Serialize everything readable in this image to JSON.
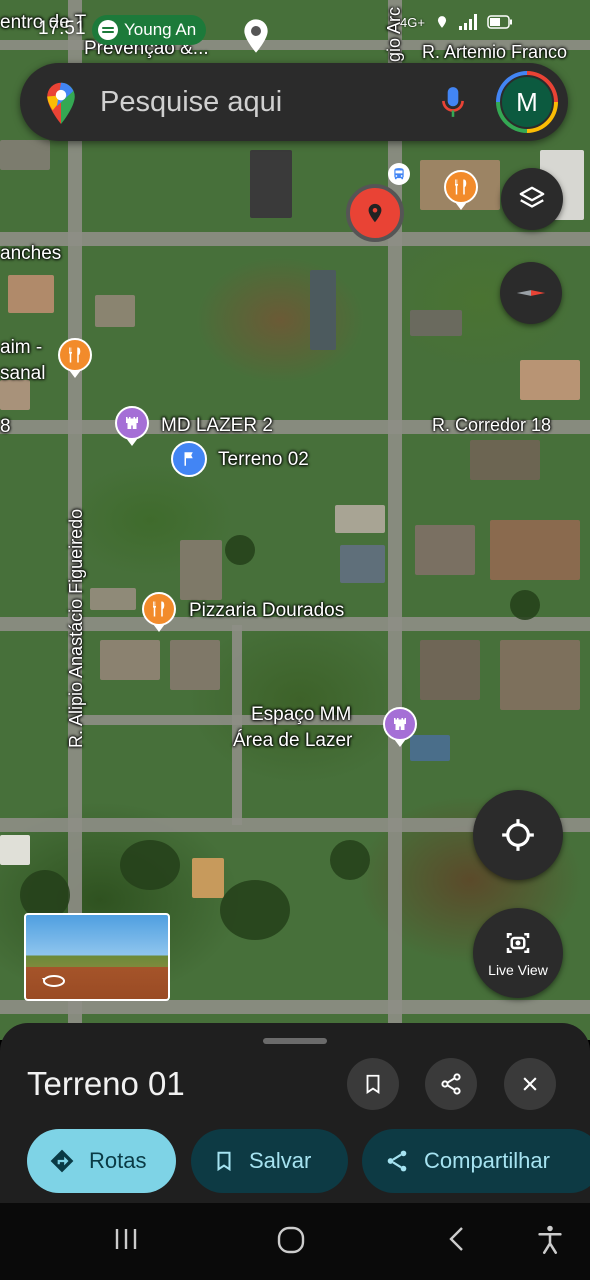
{
  "status_bar": {
    "time": "17:51",
    "spotify_text": "Young An",
    "network": "4G+"
  },
  "search": {
    "placeholder": "Pesquise aqui",
    "avatar_letter": "M"
  },
  "map": {
    "labels": {
      "top_left": "entro de T",
      "prevencao": "Prevençao &...",
      "r_artemio": "R. Artemio Franco",
      "lanches": "anches",
      "aim": "aim -",
      "sanal": "sanal",
      "left_b": "8",
      "md_lazer": "MD LAZER 2",
      "terreno_02": "Terreno 02",
      "r_corredor": "R. Corredor 18",
      "r_alipio": "R. Alipio Anastácio Figueiredo",
      "pizzaria": "Pizzaria Dourados",
      "espaco_mm_1": "Espaço MM",
      "espaco_mm_2": "Área de Lazer",
      "vertical_top": "gio Arc"
    },
    "live_view_label": "Live View"
  },
  "sheet": {
    "title": "Terreno 01",
    "directions": "Rotas",
    "save": "Salvar",
    "share": "Compartilhar"
  },
  "colors": {
    "food_pin": "#f28b2b",
    "leisure_pin": "#a56fd6",
    "selected_pin": "#e94335",
    "accent": "#7ed3e6"
  }
}
